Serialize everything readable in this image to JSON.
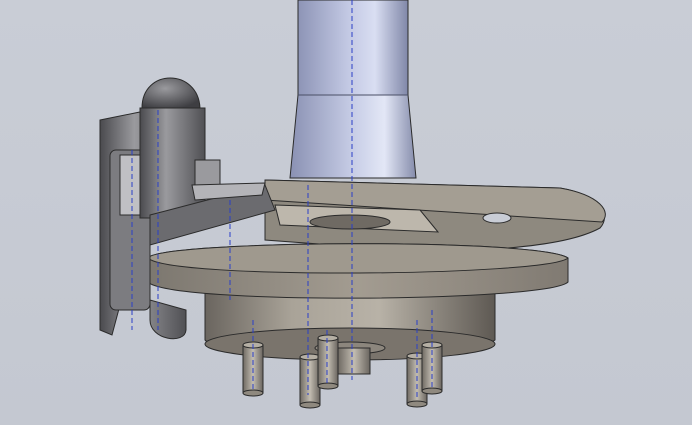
{
  "viewport": {
    "background_top": "#c9cdd6",
    "background_bottom": "#c4c8d1"
  },
  "colors": {
    "shaft_light": "#cdd3ea",
    "shaft_mid": "#9aa2c4",
    "shaft_dark": "#6c7290",
    "plate_top": "#9c968c",
    "plate_edge": "#77716a",
    "hub_light": "#b2aca2",
    "hub_dark": "#5f5a54",
    "caliper_light": "#a4a4a6",
    "caliper_dark": "#3e3e42",
    "hidden_line": "#2a3fc8",
    "outline": "#2b2b2b"
  },
  "icons": {
    "model": "cad-3d-model-icon"
  }
}
